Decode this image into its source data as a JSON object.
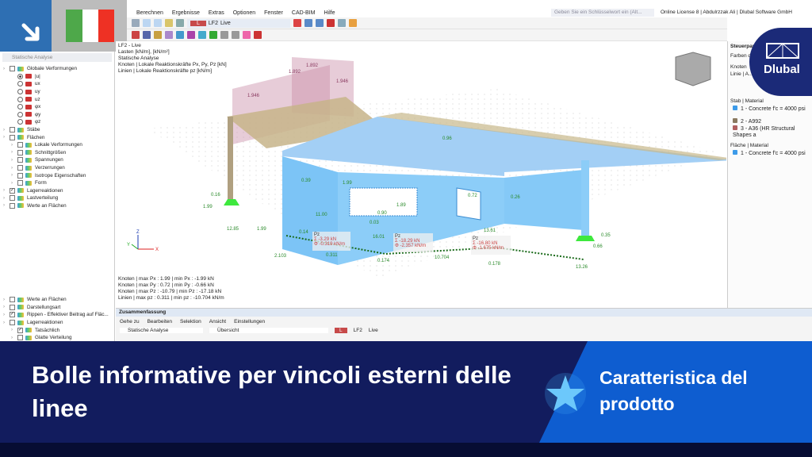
{
  "menu": [
    "Berechnen",
    "Ergebnisse",
    "Extras",
    "Optionen",
    "Fenster",
    "CAD-BIM",
    "Hilfe"
  ],
  "search_placeholder": "Geben Sie ein Schlüsselwort ein (Alt...",
  "license": "Online License 8 | Abdulrzzak Ali | Dlubal Software GmbH",
  "loadcase": {
    "type": "L",
    "id": "LF2",
    "name": "Live"
  },
  "left_panel": {
    "header": "Statische Analyse",
    "tree": [
      {
        "label": "Globale Verformungen",
        "kind": "check",
        "level": 0
      },
      {
        "label": "|u|",
        "kind": "radio",
        "level": 1,
        "selected": true
      },
      {
        "label": "ux",
        "kind": "radio",
        "level": 1
      },
      {
        "label": "uy",
        "kind": "radio",
        "level": 1
      },
      {
        "label": "uz",
        "kind": "radio",
        "level": 1
      },
      {
        "label": "φx",
        "kind": "radio",
        "level": 1
      },
      {
        "label": "φy",
        "kind": "radio",
        "level": 1
      },
      {
        "label": "φz",
        "kind": "radio",
        "level": 1
      },
      {
        "label": "Stäbe",
        "kind": "check",
        "level": 0
      },
      {
        "label": "Flächen",
        "kind": "check",
        "level": 0
      },
      {
        "label": "Lokale Verformungen",
        "kind": "check",
        "level": 1
      },
      {
        "label": "Schnittgrößen",
        "kind": "check",
        "level": 1
      },
      {
        "label": "Spannungen",
        "kind": "check",
        "level": 1
      },
      {
        "label": "Verzerrungen",
        "kind": "check",
        "level": 1
      },
      {
        "label": "Isotrope Eigenschaften",
        "kind": "check",
        "level": 1
      },
      {
        "label": "Form",
        "kind": "check",
        "level": 1
      },
      {
        "label": "Lagerreaktionen",
        "kind": "check",
        "level": 0,
        "checked": true
      },
      {
        "label": "Lastverteilung",
        "kind": "check",
        "level": 0
      },
      {
        "label": "Werte an Flächen",
        "kind": "check",
        "level": 0
      }
    ],
    "tree2": [
      {
        "label": "Werte an Flächen",
        "level": 0
      },
      {
        "label": "Darstellungsart",
        "level": 0
      },
      {
        "label": "Rippen - Effektiver Beitrag auf Fläc...",
        "level": 0,
        "checked": true
      },
      {
        "label": "Lagerreaktionen",
        "level": 0
      },
      {
        "label": "Tatsächlich",
        "level": 1,
        "checked": true
      },
      {
        "label": "Glatte Verteilung",
        "level": 1
      }
    ]
  },
  "viewport": {
    "info": [
      "LF2 - Live",
      "Lasten [kN/m], [kN/m²]",
      "Statische Analyse",
      "Knoten | Lokale Reaktionskräfte Px, Py, Pz [kN]",
      "Linien | Lokale Reaktionskräfte pz [kN/m]"
    ],
    "summary_lines": [
      "Knoten | max Px : 1.99 | min Px : -1.99 kN",
      "Knoten | max Py : 0.72 | min Py : -0.66 kN",
      "Knoten | max Pz : -10.79 | min Pz : -17.18 kN",
      "Linien | max pz : 0.311 | min pz : -10.704 kN/m"
    ],
    "load_labels": [
      "1.892",
      "1.892",
      "1.946",
      "1.946"
    ],
    "values": [
      "0.16",
      "1.99",
      "12.85",
      "1.99",
      "0.39",
      "1.99",
      "11.00",
      "0.03",
      "0.14",
      "16.01",
      "0.72",
      "13.61",
      "0.26",
      "0.35",
      "0.66",
      "13.26",
      "1.89",
      "2.103",
      "0.174",
      "10.704",
      "0.178",
      "0.311",
      "0.90",
      "0.96"
    ],
    "bubbles": [
      {
        "title": "Pz",
        "sum": "-3.29",
        "sum_unit": "kN",
        "avg": "-0.319",
        "avg_unit": "kN/m"
      },
      {
        "title": "Pz",
        "sum": "-18.29",
        "sum_unit": "kN",
        "avg": "-2.357",
        "avg_unit": "kN/m"
      },
      {
        "title": "Pz",
        "sum": "-16.80",
        "sum_unit": "kN",
        "avg": "-1.675",
        "avg_unit": "kN/m"
      }
    ],
    "axes": {
      "x": "X",
      "y": "Y",
      "z": "Z"
    }
  },
  "right_panel": {
    "title": "Steuerpanel",
    "dropdown": "Farben d...",
    "rows": [
      "Knoten",
      "Linie | A..."
    ],
    "stab_header": "Stab | Material",
    "stab_items": [
      {
        "label": "1 - Concrete f'c = 4000 psi",
        "color": "#3d9be9"
      },
      {
        "label": "2 - A992",
        "color": "#8a7a60"
      },
      {
        "label": "3 - A36 (HR Structural Shapes a",
        "color": "#b06060"
      }
    ],
    "flaeche_header": "Fläche | Material",
    "flaeche_items": [
      {
        "label": "1 - Concrete f'c = 4000 psi",
        "color": "#3d9be9"
      }
    ]
  },
  "summary": {
    "title": "Zusammenfassung",
    "menu": [
      "Gehe zu",
      "Bearbeiten",
      "Selektion",
      "Ansicht",
      "Einstellungen"
    ],
    "analysis": "Statische Analyse",
    "view": "Übersicht",
    "loadcase": {
      "type": "L",
      "id": "LF2",
      "name": "Live"
    }
  },
  "logo": "Dlubal",
  "banner": {
    "title": "Bolle informative per vincoli esterni delle linee",
    "feature": "Caratteristica del prodotto"
  }
}
